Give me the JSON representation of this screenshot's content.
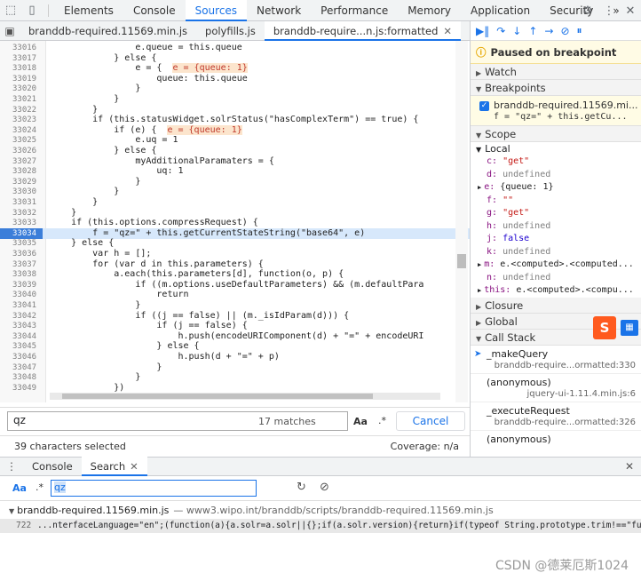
{
  "toolbar": {
    "tabs": [
      "Elements",
      "Console",
      "Sources",
      "Network",
      "Performance",
      "Memory",
      "Application",
      "Security"
    ],
    "active_tab": "Sources",
    "more": "»"
  },
  "file_tabs": [
    "branddb-required.11569.min.js",
    "polyfills.js",
    "branddb-require...n.js:formatted"
  ],
  "code_lines": [
    {
      "n": "33016",
      "code": "                e.queue = this.queue"
    },
    {
      "n": "33017",
      "code": "            } else {"
    },
    {
      "n": "33018",
      "code": "                e = {  ",
      "inline": "e = {queue: 1}"
    },
    {
      "n": "33019",
      "code": "                    queue: this.queue"
    },
    {
      "n": "33020",
      "code": "                }"
    },
    {
      "n": "33021",
      "code": "            }"
    },
    {
      "n": "33022",
      "code": "        }"
    },
    {
      "n": "33023",
      "code": "        if (this.statusWidget.solrStatus(\"hasComplexTerm\") == true) {"
    },
    {
      "n": "33024",
      "code": "            if (e) {  ",
      "inline": "e = {queue: 1}"
    },
    {
      "n": "33025",
      "code": "                e.uq = 1"
    },
    {
      "n": "33026",
      "code": "            } else {"
    },
    {
      "n": "33027",
      "code": "                myAdditionalParamaters = {"
    },
    {
      "n": "33028",
      "code": "                    uq: 1"
    },
    {
      "n": "33029",
      "code": "                }"
    },
    {
      "n": "33030",
      "code": "            }"
    },
    {
      "n": "33031",
      "code": "        }"
    },
    {
      "n": "33032",
      "code": "    }"
    },
    {
      "n": "33033",
      "code": "    if (this.options.compressRequest) {"
    },
    {
      "n": "33034",
      "code": "        f = \"qz=\" + this.getCurrentStateString(\"base64\", e)",
      "current": true
    },
    {
      "n": "33035",
      "code": "    } else {"
    },
    {
      "n": "33036",
      "code": "        var h = [];"
    },
    {
      "n": "33037",
      "code": "        for (var d in this.parameters) {"
    },
    {
      "n": "33038",
      "code": "            a.each(this.parameters[d], function(o, p) {"
    },
    {
      "n": "33039",
      "code": "                if ((m.options.useDefaultParameters) && (m.defaultPara"
    },
    {
      "n": "33040",
      "code": "                    return"
    },
    {
      "n": "33041",
      "code": "                }"
    },
    {
      "n": "33042",
      "code": "                if ((j == false) || (m._isIdParam(d))) {"
    },
    {
      "n": "33043",
      "code": "                    if (j == false) {"
    },
    {
      "n": "33044",
      "code": "                        h.push(encodeURIComponent(d) + \"=\" + encodeURI"
    },
    {
      "n": "33045",
      "code": "                    } else {"
    },
    {
      "n": "33046",
      "code": "                        h.push(d + \"=\" + p)"
    },
    {
      "n": "33047",
      "code": "                    }"
    },
    {
      "n": "33048",
      "code": "                }"
    },
    {
      "n": "33049",
      "code": "            })"
    }
  ],
  "search": {
    "query": "qz",
    "matches": "17 matches",
    "aa": "Aa",
    "regex": ".*",
    "cancel": "Cancel"
  },
  "status": {
    "selection": "39 characters selected",
    "coverage": "Coverage: n/a"
  },
  "debugger": {
    "paused": "Paused on breakpoint",
    "watch": "Watch",
    "breakpoints": "Breakpoints",
    "bp_file": "branddb-required.11569.mi...",
    "bp_code": "f = \"qz=\" + this.getCu...",
    "scope": "Scope",
    "local": "Local",
    "scope_vars": [
      {
        "k": "c",
        "v": "\"get\"",
        "t": "str"
      },
      {
        "k": "d",
        "v": "undefined",
        "t": "und"
      },
      {
        "k": "e",
        "v": "{queue: 1}",
        "t": "obj",
        "exp": true
      },
      {
        "k": "f",
        "v": "\"\"",
        "t": "str"
      },
      {
        "k": "g",
        "v": "\"get\"",
        "t": "str"
      },
      {
        "k": "h",
        "v": "undefined",
        "t": "und"
      },
      {
        "k": "j",
        "v": "false",
        "t": "num"
      },
      {
        "k": "k",
        "v": "undefined",
        "t": "und"
      },
      {
        "k": "m",
        "v": "e.<computed>.<computed...",
        "t": "obj",
        "exp": true
      },
      {
        "k": "n",
        "v": "undefined",
        "t": "und"
      },
      {
        "k": "this",
        "v": "e.<computed>.<compu...",
        "t": "obj",
        "exp": true
      }
    ],
    "closure": "Closure",
    "global": "Global",
    "call_stack": "Call Stack",
    "frames": [
      {
        "fn": "_makeQuery",
        "loc": "branddb-require...ormatted:330",
        "current": true
      },
      {
        "fn": "(anonymous)",
        "loc": "jquery-ui-1.11.4.min.js:6"
      },
      {
        "fn": "_executeRequest",
        "loc": "branddb-require...ormatted:326"
      },
      {
        "fn": "(anonymous)",
        "loc": ""
      }
    ]
  },
  "drawer": {
    "tabs": [
      "Console",
      "Search"
    ],
    "active": "Search",
    "aa": "Aa",
    "regex": ".*",
    "query": "qz",
    "result_file": "branddb-required.11569.min.js",
    "result_path": "— www3.wipo.int/branddb/scripts/branddb-required.11569.min.js",
    "result_line_num": "722",
    "result_line_text": "...nterfaceLanguage=\"en\";(function(a){a.solr=a.solr||{};if(a.solr.version){return}if(typeof String.prototype.trim!==\"function\"){String.prototype.tri..."
  },
  "watermark": "CSDN @德莱厄斯1024",
  "ime_label": "S"
}
